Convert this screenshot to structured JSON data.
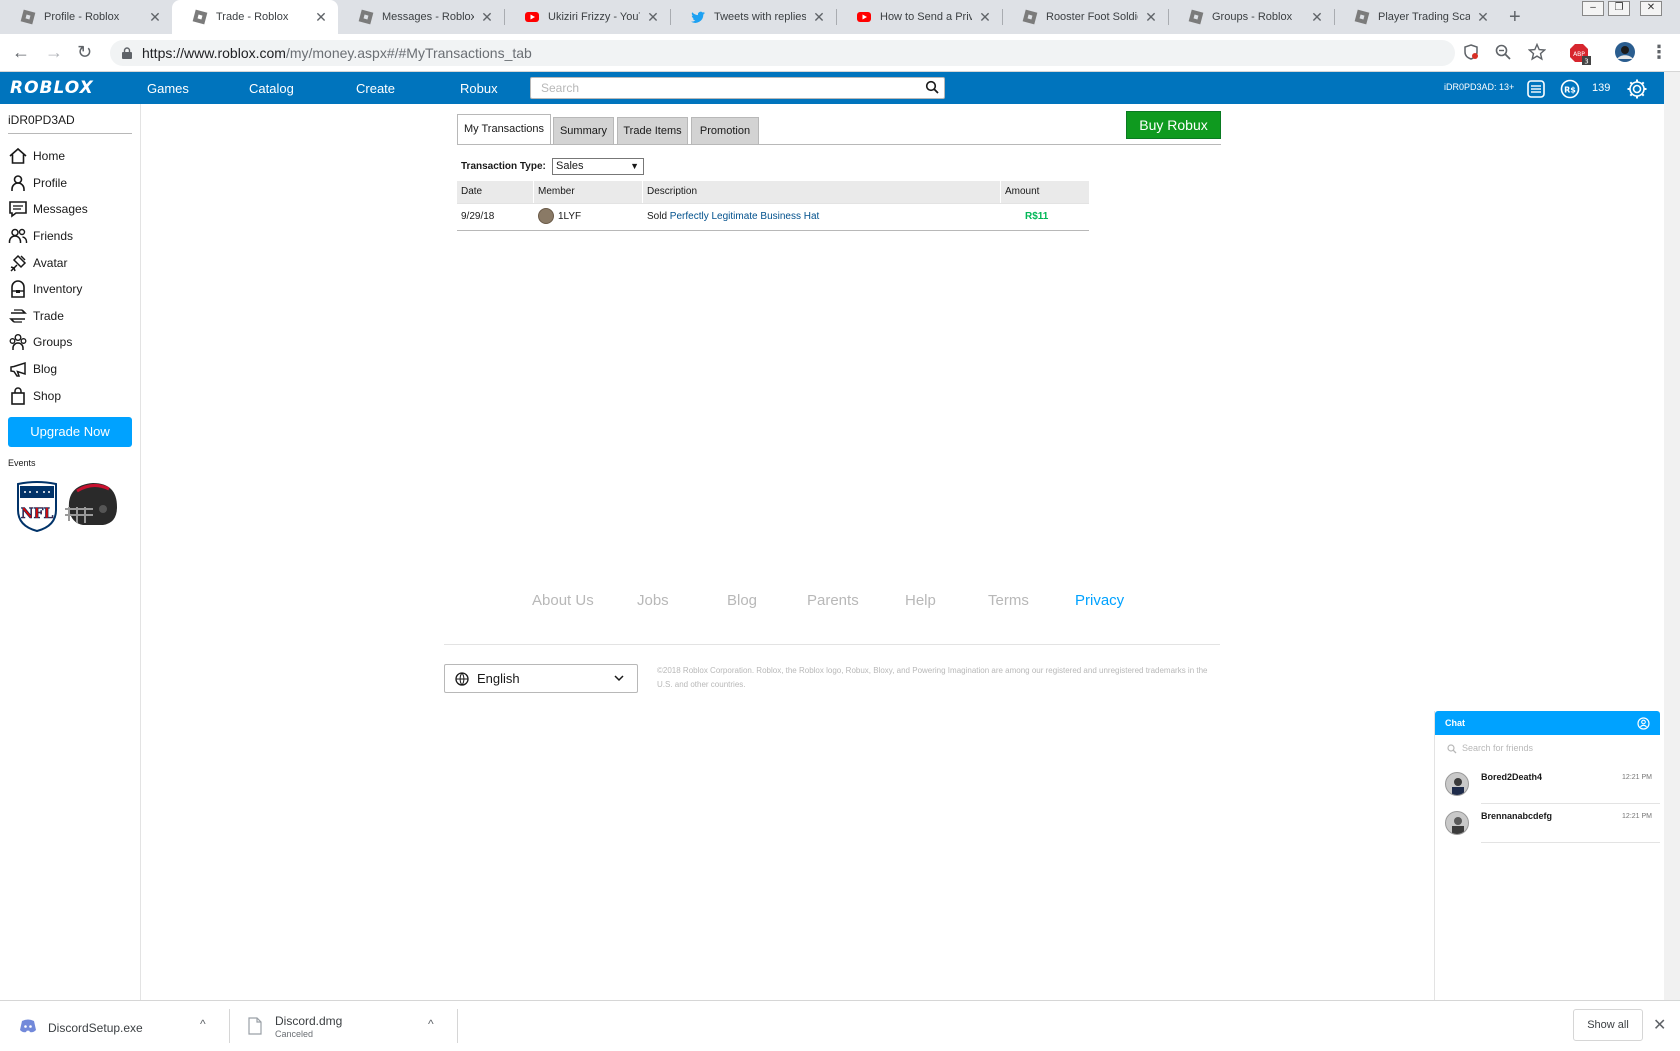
{
  "browser": {
    "tabs": [
      {
        "title": "Profile - Roblox",
        "icon": "roblox-icon"
      },
      {
        "title": "Trade - Roblox",
        "icon": "roblox-icon"
      },
      {
        "title": "Messages - Roblox",
        "icon": "roblox-icon"
      },
      {
        "title": "Ukiziri Frizzy - YouTub",
        "icon": "youtube-icon"
      },
      {
        "title": "Tweets with replies b",
        "icon": "twitter-icon"
      },
      {
        "title": "How to Send a Privat",
        "icon": "youtube-icon"
      },
      {
        "title": "Rooster Foot Soldier",
        "icon": "roblox-icon"
      },
      {
        "title": "Groups - Roblox",
        "icon": "roblox-icon"
      },
      {
        "title": "Player Trading Scams",
        "icon": "roblox-icon"
      }
    ],
    "active_tab_index": 1,
    "url_host": "https://www.roblox.com",
    "url_path": "/my/money.aspx#/#MyTransactions_tab",
    "extension_badge": "3"
  },
  "header": {
    "logo": "ROBLOX",
    "nav": [
      "Games",
      "Catalog",
      "Create",
      "Robux"
    ],
    "search_placeholder": "Search",
    "user": "iDR0PD3AD: 13+",
    "robux": "139"
  },
  "sidebar": {
    "username": "iDR0PD3AD",
    "items": [
      {
        "label": "Home",
        "icon": "home-icon"
      },
      {
        "label": "Profile",
        "icon": "profile-icon"
      },
      {
        "label": "Messages",
        "icon": "messages-icon"
      },
      {
        "label": "Friends",
        "icon": "friends-icon"
      },
      {
        "label": "Avatar",
        "icon": "avatar-icon"
      },
      {
        "label": "Inventory",
        "icon": "inventory-icon"
      },
      {
        "label": "Trade",
        "icon": "trade-icon"
      },
      {
        "label": "Groups",
        "icon": "groups-icon"
      },
      {
        "label": "Blog",
        "icon": "blog-icon"
      },
      {
        "label": "Shop",
        "icon": "shop-icon"
      }
    ],
    "upgrade_label": "Upgrade Now",
    "events_label": "Events"
  },
  "main": {
    "tabs": [
      "My Transactions",
      "Summary",
      "Trade Items",
      "Promotion"
    ],
    "buy_robux_label": "Buy Robux",
    "transaction_type_label": "Transaction Type:",
    "transaction_type_value": "Sales",
    "table": {
      "columns": [
        "Date",
        "Member",
        "Description",
        "Amount"
      ],
      "rows": [
        {
          "date": "9/29/18",
          "member": "1LYF",
          "description_prefix": "Sold",
          "description_item": "Perfectly Legitimate Business Hat",
          "amount": "R$11"
        }
      ]
    }
  },
  "footer": {
    "links": [
      "About Us",
      "Jobs",
      "Blog",
      "Parents",
      "Help",
      "Terms",
      "Privacy"
    ],
    "language": "English",
    "copyright": "©2018 Roblox Corporation. Roblox, the Roblox logo, Robux, Bloxy, and Powering Imagination are among our registered and unregistered trademarks in the U.S. and other countries."
  },
  "chat": {
    "title": "Chat",
    "search_placeholder": "Search for friends",
    "friends": [
      {
        "name": "Bored2Death4",
        "time": "12:21 PM"
      },
      {
        "name": "Brennanabcdefg",
        "time": "12:21 PM"
      }
    ]
  },
  "downloads": {
    "items": [
      {
        "name": "DiscordSetup.exe",
        "status": ""
      },
      {
        "name": "Discord.dmg",
        "status": "Canceled"
      }
    ],
    "show_all_label": "Show all"
  },
  "colors": {
    "roblox_blue": "#0074bd",
    "accent_blue": "#00a2ff",
    "buy_green": "#0f9a1f",
    "robux_green": "#02b757"
  }
}
